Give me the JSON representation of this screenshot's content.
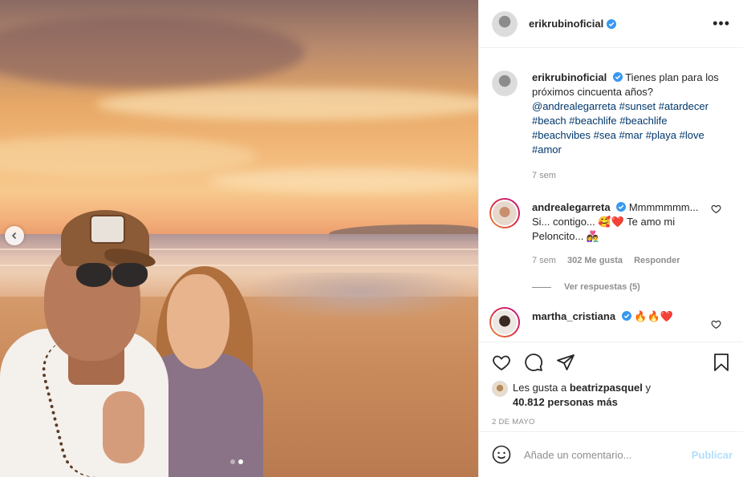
{
  "post": {
    "author": "erikrubinoficial",
    "more_icon": "more-horizontal-icon"
  },
  "caption": {
    "author": "erikrubinoficial",
    "text": "Tienes plan para los próximos cincuenta años?",
    "tags": [
      "@andrealegarreta",
      "#sunset",
      "#atardecer",
      "#beach",
      "#beachlife",
      "#beachlife",
      "#beachvibes",
      "#sea",
      "#mar",
      "#playa",
      "#love",
      "#amor"
    ],
    "time": "7 sem"
  },
  "comments": [
    {
      "author": "andrealegarreta",
      "text": "Mmmmmmm... Si... contigo... 🥰❤️ Te amo mi Peloncito... 👩‍❤️‍👨",
      "time": "7 sem",
      "likes": "302 Me gusta",
      "reply_label": "Responder",
      "view_replies": "Ver respuestas (5)"
    },
    {
      "author": "martha_cristiana",
      "text": "🔥🔥❤️"
    }
  ],
  "likes": {
    "prefix": "Les gusta a",
    "user": "beatrizpasquel",
    "joiner": "y",
    "count": "40.812 personas más"
  },
  "date": "2 DE MAYO",
  "add_comment": {
    "placeholder": "Añade un comentario...",
    "publish_label": "Publicar"
  },
  "carousel": {
    "total": 2,
    "active": 2
  },
  "colors": {
    "link": "#00376b",
    "verified": "#3897f0",
    "publish_disabled": "#b2dffc"
  }
}
